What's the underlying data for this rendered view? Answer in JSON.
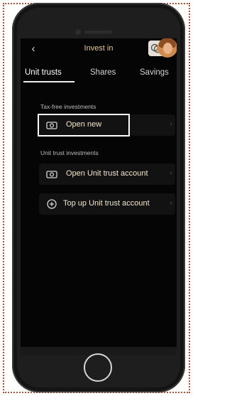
{
  "header": {
    "back_icon": "chevron-left-icon",
    "title": "Invest in",
    "badge_icon": "chat-bubbles-icon"
  },
  "tabs": [
    {
      "label": "Unit trusts",
      "active": true
    },
    {
      "label": "Shares",
      "active": false
    },
    {
      "label": "Savings",
      "active": false
    }
  ],
  "sections": [
    {
      "title": "Tax-free investments",
      "items": [
        {
          "label": "Open new",
          "icon": "camera-icon",
          "highlighted": true
        }
      ]
    },
    {
      "title": "Unit trust investments",
      "items": [
        {
          "label": "Open Unit trust account",
          "icon": "camera-icon"
        },
        {
          "label": "Top up Unit trust account",
          "icon": "plus-circle-icon"
        }
      ]
    }
  ],
  "colors": {
    "accent": "#e3c9a0",
    "background": "#050505",
    "highlight_border": "#ffffff"
  }
}
